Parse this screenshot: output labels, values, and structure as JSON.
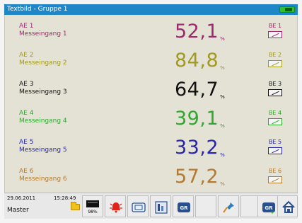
{
  "window": {
    "title": "Textbild - Gruppe 1"
  },
  "rows": [
    {
      "ae": "AE 1",
      "name": "Messeingang 1",
      "value": "52,1",
      "unit": "%",
      "be": "BE 1",
      "color": "#a0286e"
    },
    {
      "ae": "AE 2",
      "name": "Messeingang 2",
      "value": "84,8",
      "unit": "%",
      "be": "BE 2",
      "color": "#a29a1f"
    },
    {
      "ae": "AE 3",
      "name": "Messeingang 3",
      "value": "64,7",
      "unit": "%",
      "be": "BE 3",
      "color": "#111111"
    },
    {
      "ae": "AE 4",
      "name": "Messeingang 4",
      "value": "39,1",
      "unit": "%",
      "be": "BE 4",
      "color": "#2ea82e"
    },
    {
      "ae": "AE 5",
      "name": "Messeingang 5",
      "value": "33,2",
      "unit": "%",
      "be": "BE 5",
      "color": "#2727a8"
    },
    {
      "ae": "AE 6",
      "name": "Messeingang 6",
      "value": "57,2",
      "unit": "%",
      "be": "BE 6",
      "color": "#b47a2e"
    }
  ],
  "status": {
    "date": "29.06.2011",
    "time": "15:28:49",
    "user": "Master",
    "memory": "98%"
  },
  "toolbar": {
    "icons": [
      "memory-icon",
      "alarm-icon",
      "record-icon",
      "calendar-icon",
      "group-icon",
      "pin-icon",
      "group-select-icon",
      "home-icon"
    ],
    "group_label": "GR"
  },
  "colors": {
    "title_bar": "#1f86c8",
    "content_bg": "#e3e2d5",
    "indicator": "#2fbf2f"
  }
}
